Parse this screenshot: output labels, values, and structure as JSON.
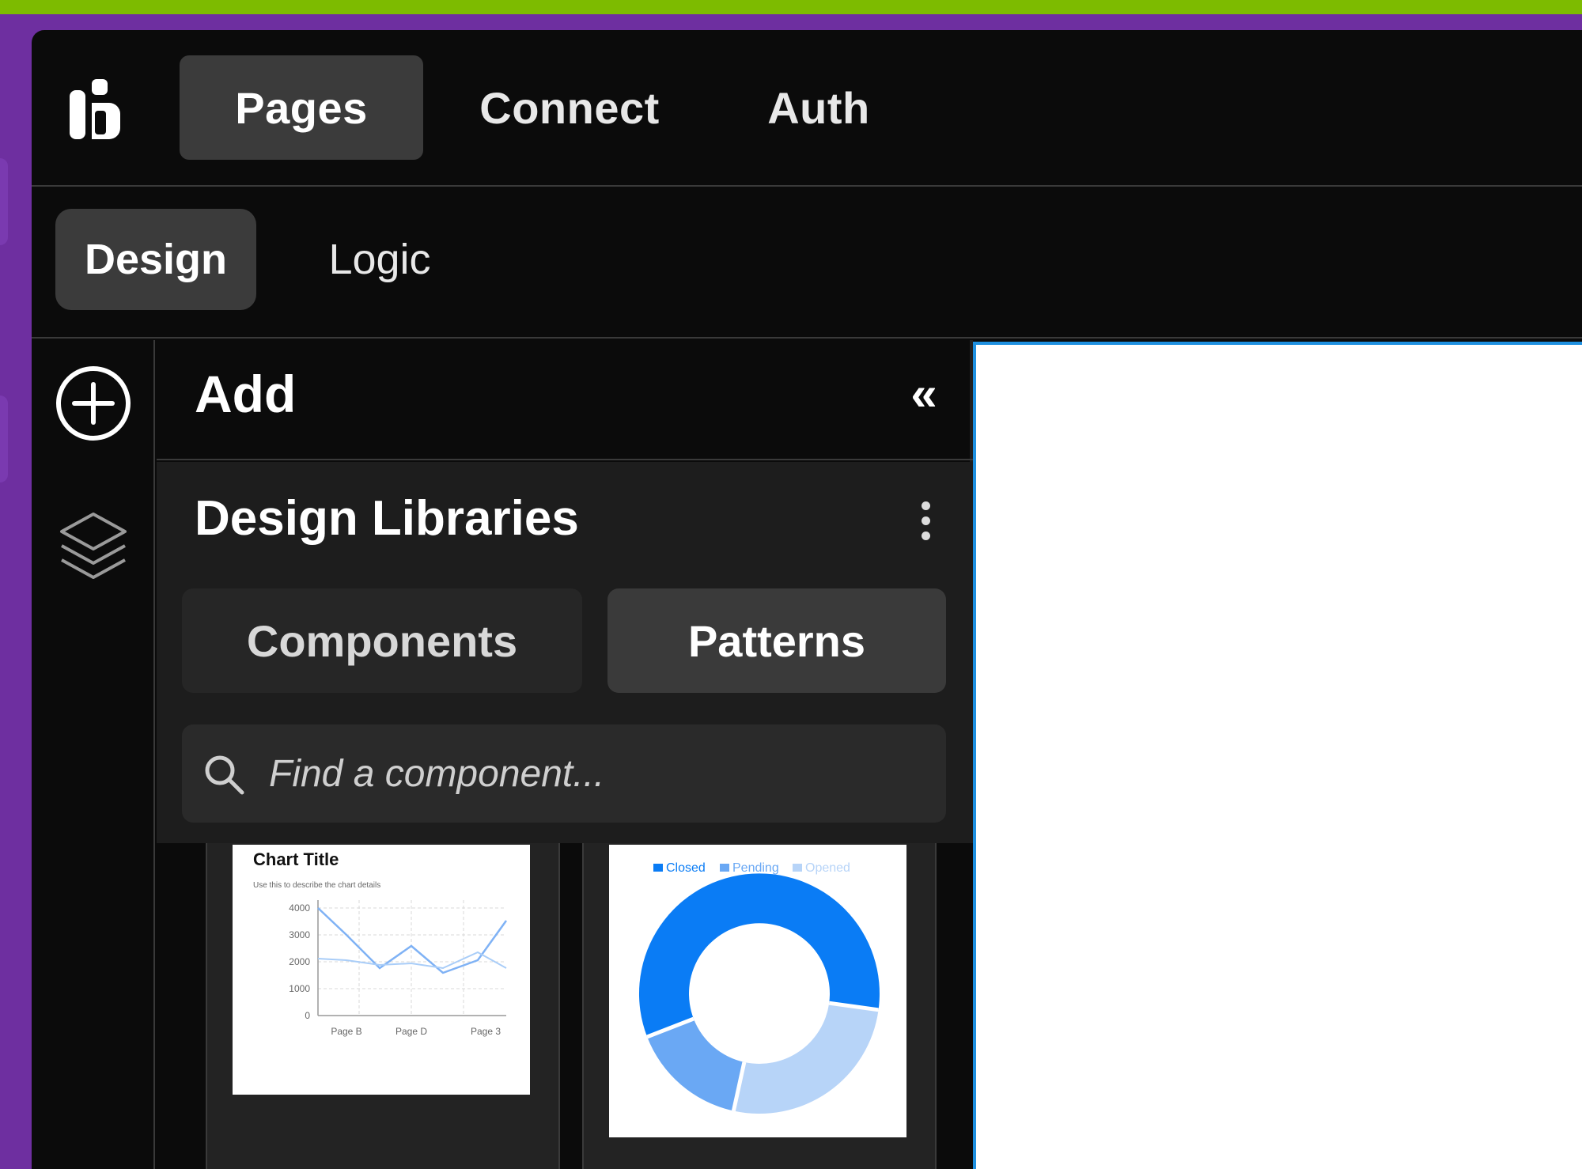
{
  "nav": {
    "tabs": [
      {
        "label": "Pages",
        "active": true
      },
      {
        "label": "Connect",
        "active": false
      },
      {
        "label": "Auth",
        "active": false
      }
    ]
  },
  "subnav": {
    "tabs": [
      {
        "label": "Design",
        "active": true
      },
      {
        "label": "Logic",
        "active": false
      }
    ]
  },
  "rail": {
    "icons": [
      "plus-circle-icon",
      "layers-icon"
    ]
  },
  "panel": {
    "title": "Add",
    "collapse_glyph": "«",
    "section_title": "Design Libraries",
    "segments": [
      {
        "label": "Components",
        "active": false
      },
      {
        "label": "Patterns",
        "active": true
      }
    ],
    "search": {
      "placeholder": "Find a component..."
    }
  },
  "cards": {
    "line_chart": {
      "title": "Chart Title",
      "subtitle": "Use this to describe the chart details",
      "y_ticks": [
        "4000",
        "3000",
        "2000",
        "1000",
        "0"
      ],
      "x_ticks": [
        "Page B",
        "Page D",
        "Page 3"
      ]
    },
    "donut_chart": {
      "legend": [
        "Closed",
        "Pending",
        "Opened"
      ],
      "colors": [
        "#0a7cf5",
        "#6aa8f4",
        "#b7d4f8"
      ]
    }
  },
  "colors": {
    "accent_bar": "#7dbb00",
    "background_purple": "#6e2fa0",
    "canvas_border": "#1e90e0"
  }
}
